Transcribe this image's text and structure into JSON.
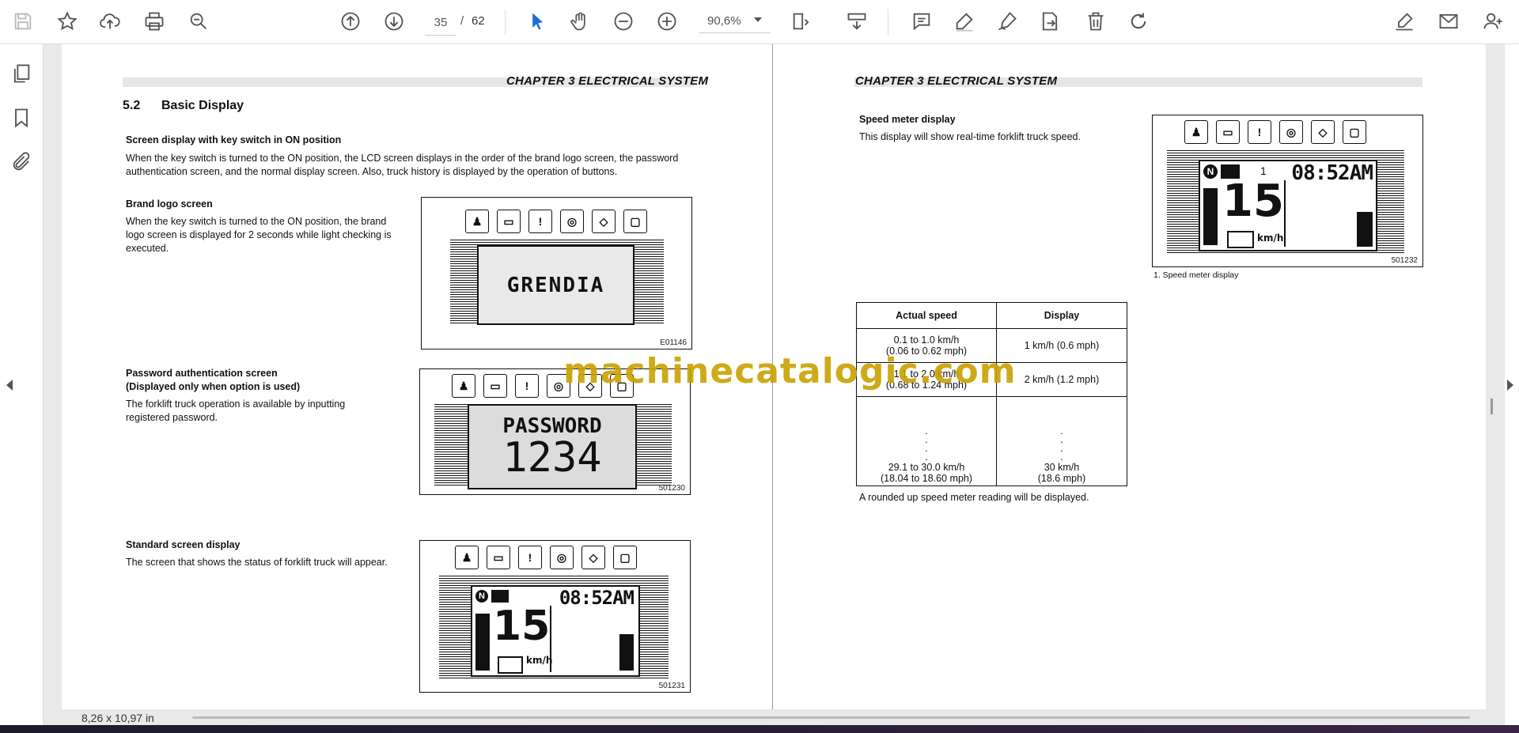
{
  "toolbar": {
    "page_current": "35",
    "page_separator": "/",
    "page_total": "62",
    "zoom": "90,6%",
    "icons": [
      "save-icon",
      "star-icon",
      "upload-icon",
      "print-icon",
      "zoom-search-icon",
      "page-up-icon",
      "page-down-icon",
      "select-cursor-icon",
      "hand-icon",
      "zoom-out-icon",
      "zoom-in-icon",
      "fit-page-icon",
      "scroll-mode-icon",
      "comment-icon",
      "highlight-icon",
      "sign-icon",
      "export-icon",
      "delete-icon",
      "rotate-icon",
      "fill-sign-icon",
      "email-icon",
      "share-user-icon"
    ]
  },
  "rail": {
    "icons": [
      "pages-icon",
      "bookmark-icon",
      "attachment-icon"
    ]
  },
  "left_page": {
    "chapter": "CHAPTER 3 ELECTRICAL SYSTEM",
    "section_number": "5.2",
    "section_title": "Basic Display",
    "s1_title": "Screen display with key switch in ON position",
    "s1_text_1": "When the key switch is turned to the ON position, the LCD screen displays in the order of the brand logo screen, the password",
    "s1_text_2": "authentication screen, and the normal display screen. Also, truck history is displayed by the operation of buttons.",
    "s2_title": "Brand logo screen",
    "s2_text_1": "When the key switch is turned to the ON position, the brand",
    "s2_text_2": "logo screen is displayed for 2 seconds while light checking is",
    "s2_text_3": "executed.",
    "s2_fig_text": "GRENDIA",
    "s2_fig_code": "E01146",
    "s3_title_1": "Password authentication screen",
    "s3_title_2": "(Displayed only when option is used)",
    "s3_text_1": "The  forklift  truck  operation  is  available  by  inputting",
    "s3_text_2": "registered password.",
    "s3_fig_line1": "PASSWORD",
    "s3_fig_line2": "1234",
    "s3_fig_code": "501230",
    "s4_title": "Standard screen display",
    "s4_text": "The screen that shows the status of forklift truck will appear.",
    "s4_fig_time": "08:52AM",
    "s4_fig_speed": "15",
    "s4_fig_unit": "km/h",
    "s4_fig_code": "501231"
  },
  "right_page": {
    "chapter": "CHAPTER 3 ELECTRICAL SYSTEM",
    "title": "Speed meter display",
    "text": "This display will show real-time forklift truck speed.",
    "fig_gear": "1",
    "fig_time": "08:52AM",
    "fig_speed": "15",
    "fig_unit": "km/h",
    "fig_code": "501232",
    "fig_caption": "1.  Speed meter display",
    "table": {
      "headers": [
        "Actual speed",
        "Display"
      ],
      "rows": [
        {
          "a1": "0.1 to 1.0 km/h",
          "a2": "(0.06 to 0.62 mph)",
          "d1": "1 km/h (0.6 mph)"
        },
        {
          "a1": "1.1 to 2.0 km/h",
          "a2": "(0.68 to 1.24 mph)",
          "d1": "2 km/h (1.2 mph)"
        },
        {
          "a1": "29.1 to 30.0 km/h",
          "a2": "(18.04 to 18.60 mph)",
          "d1": "30 km/h",
          "d2": "(18.6 mph)"
        }
      ]
    },
    "footnote": "A rounded up speed meter reading will be displayed."
  },
  "watermark": "machinecatalogic.com",
  "status": {
    "page_size": "8,26 x 10,97 in"
  }
}
